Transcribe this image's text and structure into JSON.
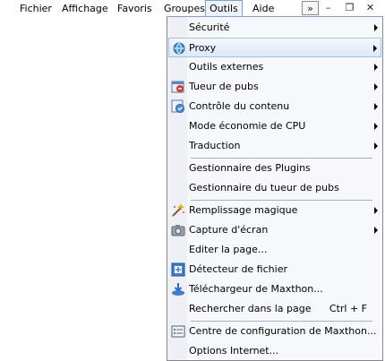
{
  "menubar": {
    "items": [
      "Fichier",
      "Affichage",
      "Favoris",
      "Groupes",
      "Outils",
      "Aide"
    ],
    "active": "Outils"
  },
  "window_controls": {
    "chevrons": "»",
    "minimize": "–",
    "restore": "❐",
    "close": "✕"
  },
  "menu": {
    "items": [
      {
        "label": "Sécurité",
        "submenu": true
      },
      {
        "label": "Proxy",
        "submenu": true,
        "highlighted": true,
        "icon": "proxy-icon"
      },
      {
        "label": "Outils externes",
        "submenu": true
      },
      {
        "label": "Tueur de pubs",
        "submenu": true,
        "icon": "ad-killer-icon"
      },
      {
        "label": "Contrôle du contenu",
        "submenu": true,
        "icon": "content-control-icon"
      },
      {
        "label": "Mode économie de CPU",
        "submenu": true
      },
      {
        "label": "Traduction",
        "submenu": true
      },
      {
        "label": "Gestionnaire des Plugins"
      },
      {
        "label": "Gestionnaire du tueur de pubs"
      },
      {
        "label": "Remplissage magique",
        "submenu": true,
        "icon": "magic-fill-icon"
      },
      {
        "label": "Capture d'écran",
        "submenu": true,
        "icon": "camera-icon"
      },
      {
        "label": "Editer la page..."
      },
      {
        "label": "Détecteur de fichier",
        "icon": "file-detector-icon"
      },
      {
        "label": "Téléchargeur de Maxthon...",
        "icon": "downloader-icon"
      },
      {
        "label": "Rechercher dans la page",
        "shortcut": "Ctrl + F"
      },
      {
        "label": "Centre de configuration de Maxthon...",
        "icon": "config-center-icon"
      },
      {
        "label": "Options Internet..."
      }
    ]
  }
}
